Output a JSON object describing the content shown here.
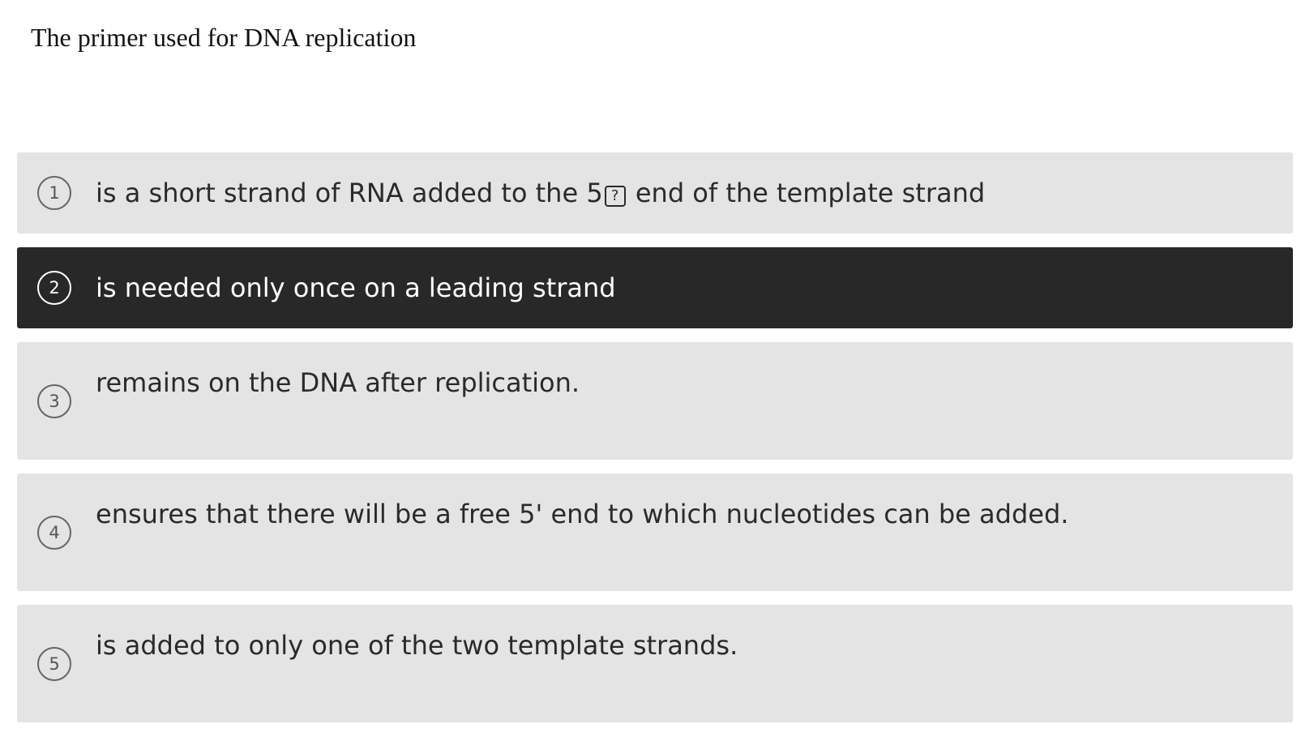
{
  "question": "The primer used for DNA replication",
  "options": [
    {
      "number": "1",
      "text_before": "is a short strand of RNA added to the 5",
      "glyph": "?",
      "text_after": " end of the template strand",
      "selected": false
    },
    {
      "number": "2",
      "text": "is needed only once on a leading strand",
      "selected": true
    },
    {
      "number": "3",
      "text": "remains on the DNA after replication.",
      "selected": false
    },
    {
      "number": "4",
      "text": "ensures that there will be a free 5' end to which nucleotides can be added.",
      "selected": false
    },
    {
      "number": "5",
      "text": "is added to only one of the two template strands.",
      "selected": false
    }
  ],
  "colors": {
    "option_bg": "#e4e4e4",
    "selected_bg": "#282828",
    "selected_text": "#ffffff"
  }
}
